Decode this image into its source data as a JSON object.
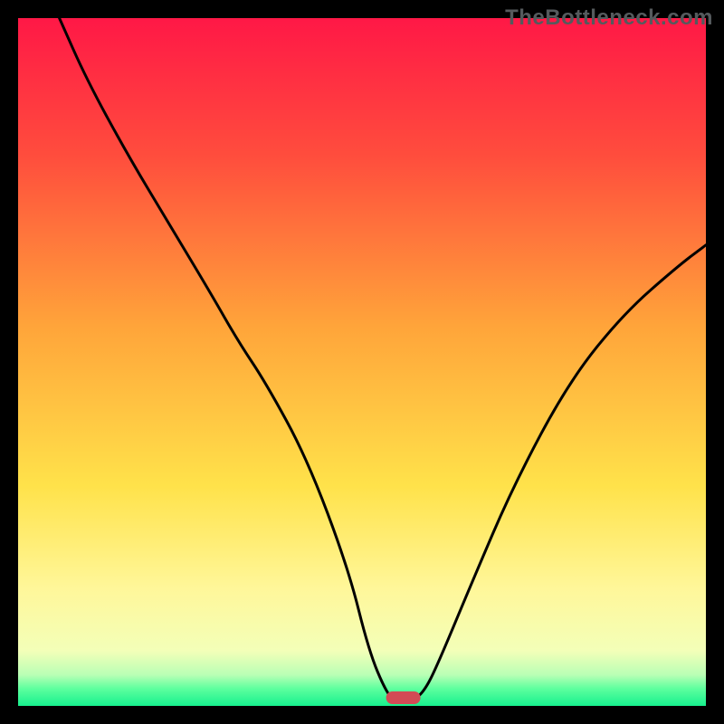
{
  "watermark": "TheBottleneck.com",
  "chart_data": {
    "type": "line",
    "title": "",
    "xlabel": "",
    "ylabel": "",
    "xlim": [
      0,
      100
    ],
    "ylim": [
      0,
      100
    ],
    "grid": false,
    "legend": false,
    "annotations": [],
    "background": {
      "description": "vertical gradient red → orange → yellow → pale-yellow → green band at bottom",
      "stops": [
        {
          "offset": 0.0,
          "color": "#ff1846"
        },
        {
          "offset": 0.2,
          "color": "#ff4d3d"
        },
        {
          "offset": 0.45,
          "color": "#ffa53a"
        },
        {
          "offset": 0.68,
          "color": "#ffe24a"
        },
        {
          "offset": 0.83,
          "color": "#fff79a"
        },
        {
          "offset": 0.92,
          "color": "#f3ffb8"
        },
        {
          "offset": 0.955,
          "color": "#b9ffb5"
        },
        {
          "offset": 0.975,
          "color": "#5dff9e"
        },
        {
          "offset": 1.0,
          "color": "#17f08e"
        }
      ]
    },
    "series": [
      {
        "name": "bottleneck-curve",
        "color": "#000000",
        "x": [
          6,
          10,
          16,
          22,
          28,
          32,
          36,
          42,
          48,
          51,
          53.5,
          55,
          57,
          59,
          61,
          66,
          72,
          80,
          88,
          96,
          100
        ],
        "y": [
          100,
          91,
          80,
          70,
          60,
          53,
          47,
          36,
          20,
          8,
          2,
          0.5,
          0.5,
          2,
          6,
          18,
          32,
          47,
          57,
          64,
          67
        ]
      }
    ],
    "marker": {
      "description": "rounded red bar at minimum of curve",
      "x_center": 56,
      "y": 0,
      "width": 5,
      "color": "#d24a55"
    }
  }
}
